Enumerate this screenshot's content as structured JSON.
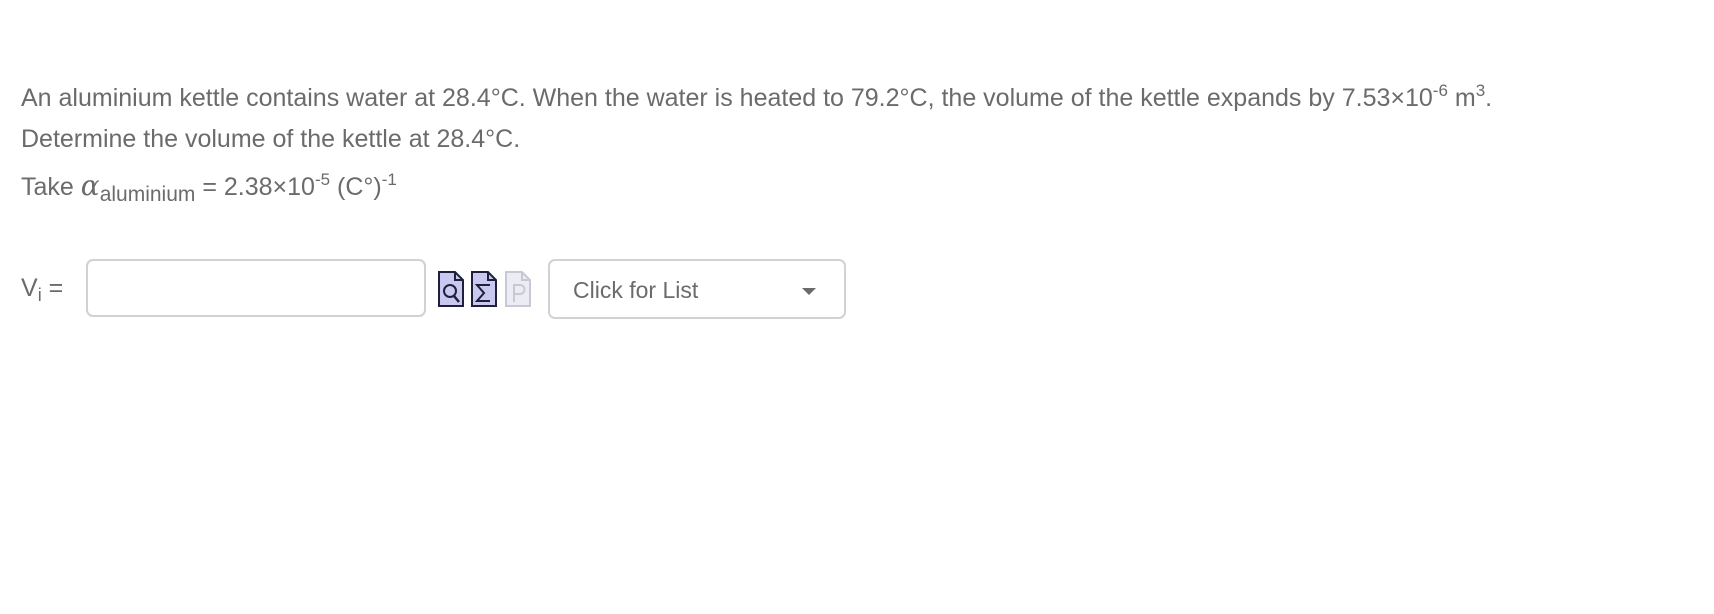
{
  "question": {
    "line1_pre": "An aluminium kettle contains water at 28.4°C. When the water is heated to 79.2°C, the volume of the kettle expands by 7.53×10",
    "line1_exp": "-6",
    "line1_unit": " m",
    "line1_unit_exp": "3",
    "line1_end": ".",
    "line2": "Determine the volume of the kettle at 28.4°C.",
    "line3_take": "Take ",
    "alpha_symbol": "α",
    "alpha_subscript": "aluminium",
    "line3_value": " = 2.38×10",
    "line3_exp": "-5",
    "line3_unit": " (C°)",
    "line3_unit_exp": "-1"
  },
  "answer": {
    "label_main": "V",
    "label_sub": "i",
    "label_eq": " =",
    "input_value": "",
    "input_placeholder": ""
  },
  "tools": [
    {
      "icon": "preview-icon",
      "state": "enabled"
    },
    {
      "icon": "equation-editor-icon",
      "state": "enabled"
    },
    {
      "icon": "hint-icon",
      "state": "disabled"
    }
  ],
  "unit_select": {
    "selected": "Click for List"
  },
  "colors": {
    "text": "#6b6b6b",
    "border": "#d2d2d2",
    "icon_fill": "#c8c8f0",
    "icon_stroke": "#1f1f3a",
    "icon_disabled": "#c9c9d6"
  }
}
